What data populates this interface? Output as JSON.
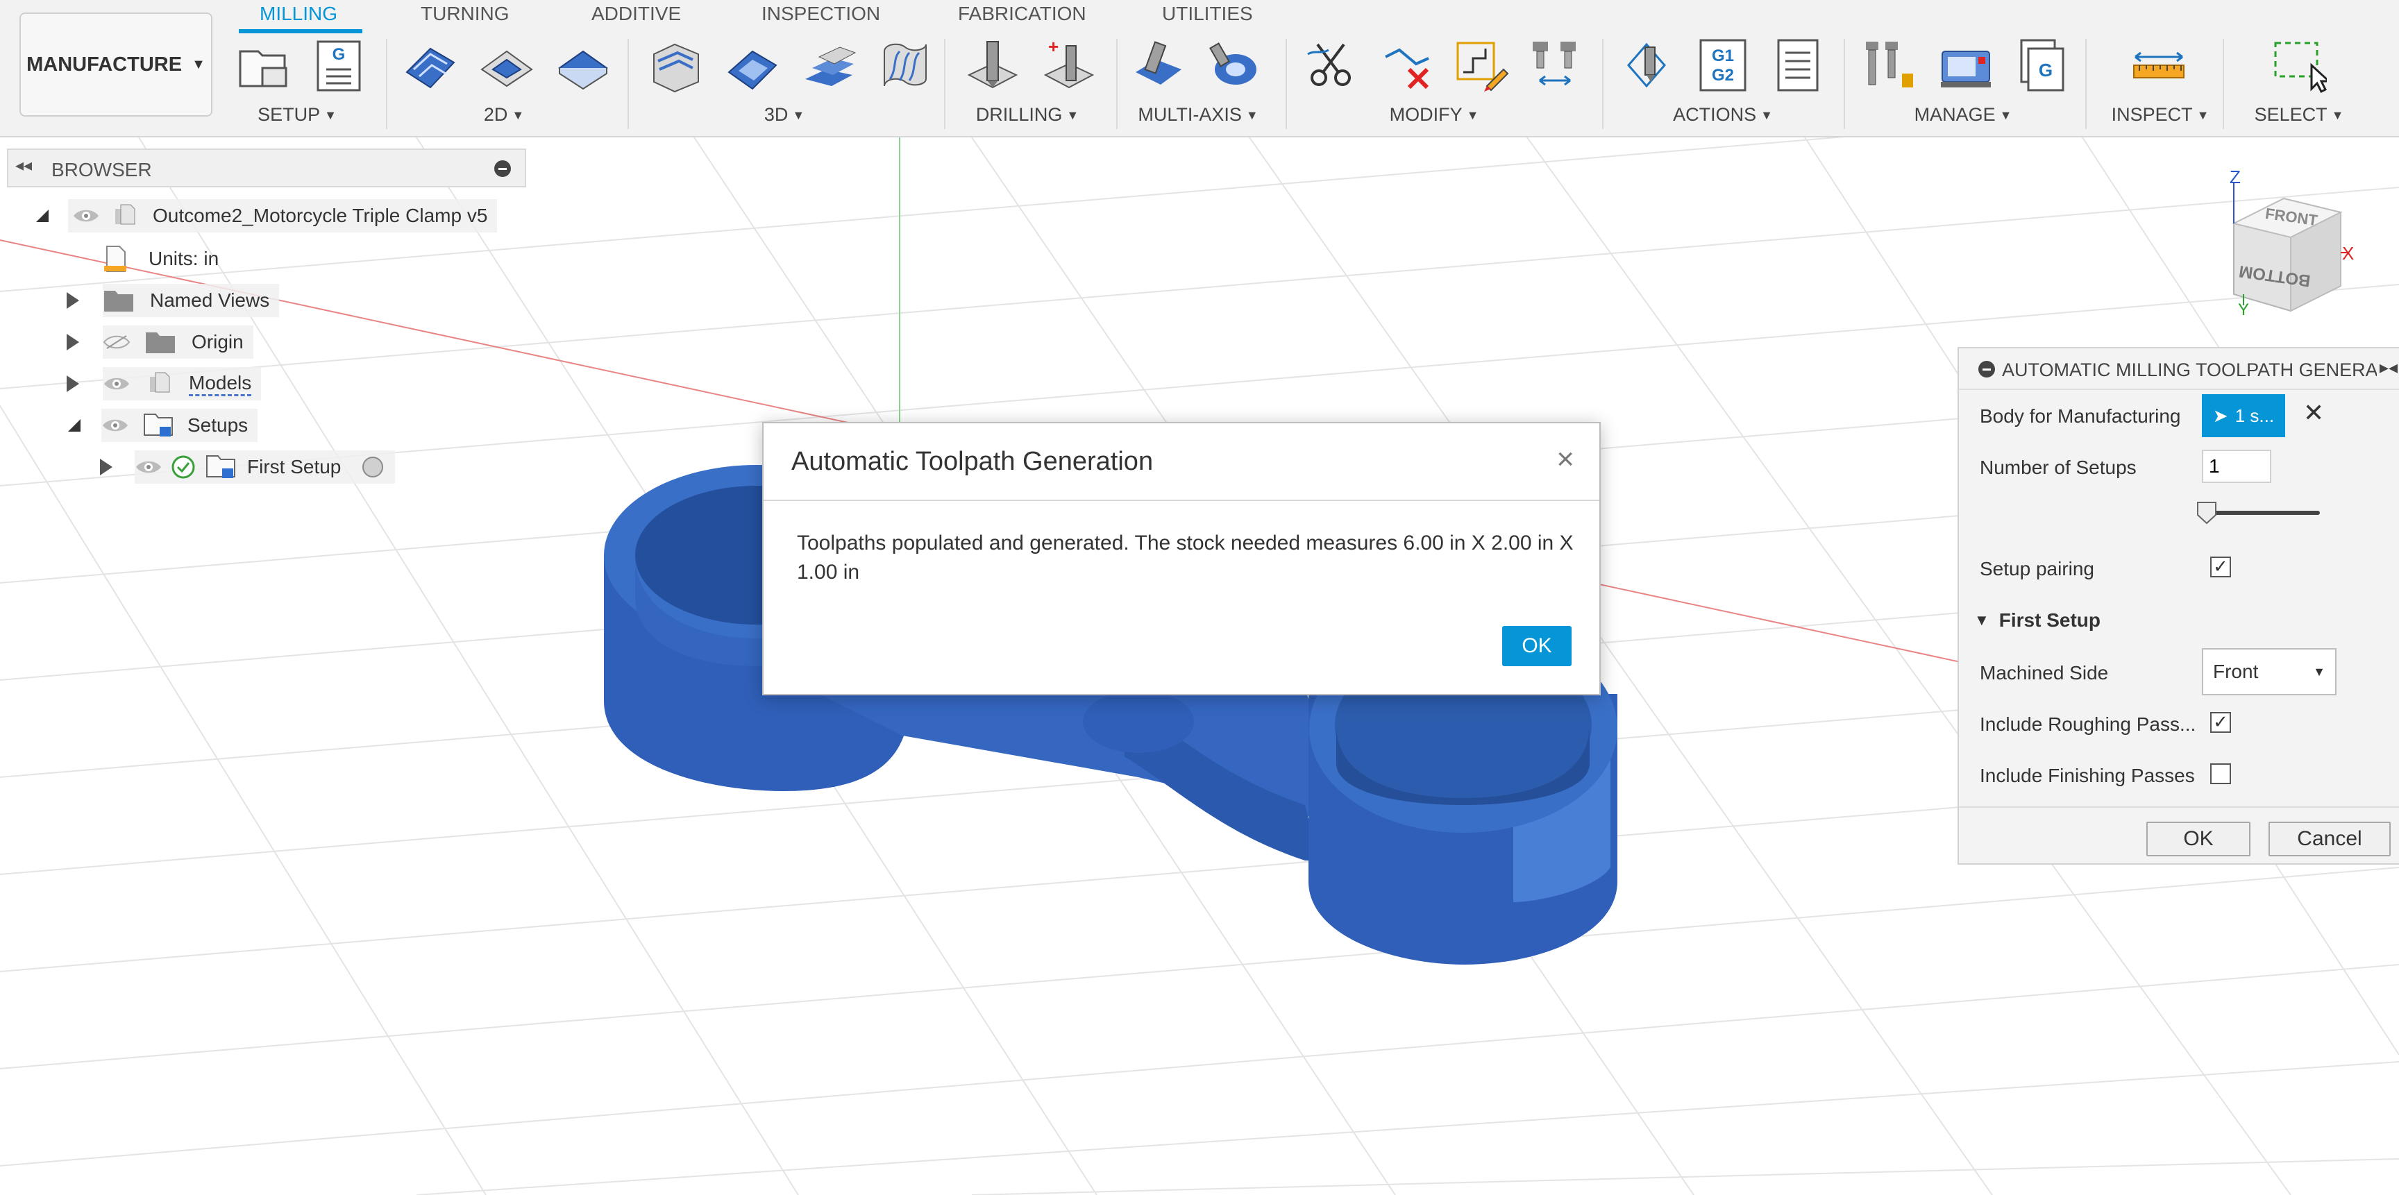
{
  "workspace": {
    "label": "MANUFACTURE"
  },
  "tabs": [
    {
      "label": "MILLING",
      "active": true
    },
    {
      "label": "TURNING"
    },
    {
      "label": "ADDITIVE"
    },
    {
      "label": "INSPECTION"
    },
    {
      "label": "FABRICATION"
    },
    {
      "label": "UTILITIES"
    }
  ],
  "groups": {
    "setup": "SETUP",
    "g2d": "2D",
    "g3d": "3D",
    "drilling": "DRILLING",
    "multiaxis": "MULTI-AXIS",
    "modify": "MODIFY",
    "actions": "ACTIONS",
    "manage": "MANAGE",
    "inspect": "INSPECT",
    "select": "SELECT"
  },
  "icons": {
    "nc_program_letter": "G",
    "post_g1": "G1",
    "post_g2": "G2",
    "manage_letter": "G"
  },
  "browser": {
    "title": "BROWSER",
    "root": "Outcome2_Motorcycle Triple Clamp v5",
    "units": "Units: in",
    "named_views": "Named Views",
    "origin": "Origin",
    "models": "Models",
    "setups": "Setups",
    "first_setup": "First Setup"
  },
  "viewcube": {
    "front": "FRONT",
    "bottom": "BOTTOM",
    "axis_x": "X",
    "axis_y": "Y",
    "axis_z": "Z"
  },
  "dialog": {
    "title": "Automatic Toolpath Generation",
    "message": "Toolpaths populated and generated. The stock needed measures 6.00 in X 2.00 in X 1.00 in",
    "ok": "OK",
    "close": "×"
  },
  "panel": {
    "title": "AUTOMATIC MILLING TOOLPATH GENERATION",
    "body_label": "Body for Manufacturing",
    "body_value": "1 s...",
    "num_setups_label": "Number of Setups",
    "num_setups_value": "1",
    "num_setups_slider_fraction": 0.0,
    "setup_pairing_label": "Setup pairing",
    "setup_pairing_checked": true,
    "section_label": "First Setup",
    "machined_side_label": "Machined Side",
    "machined_side_value": "Front",
    "roughing_label": "Include Roughing Pass...",
    "roughing_checked": true,
    "finishing_label": "Include Finishing Passes",
    "finishing_checked": false,
    "ok": "OK",
    "cancel": "Cancel"
  },
  "colors": {
    "accent": "#0696d7",
    "model_blue": "#3a6fc7",
    "toolbar_bg": "#f2f2f2"
  }
}
